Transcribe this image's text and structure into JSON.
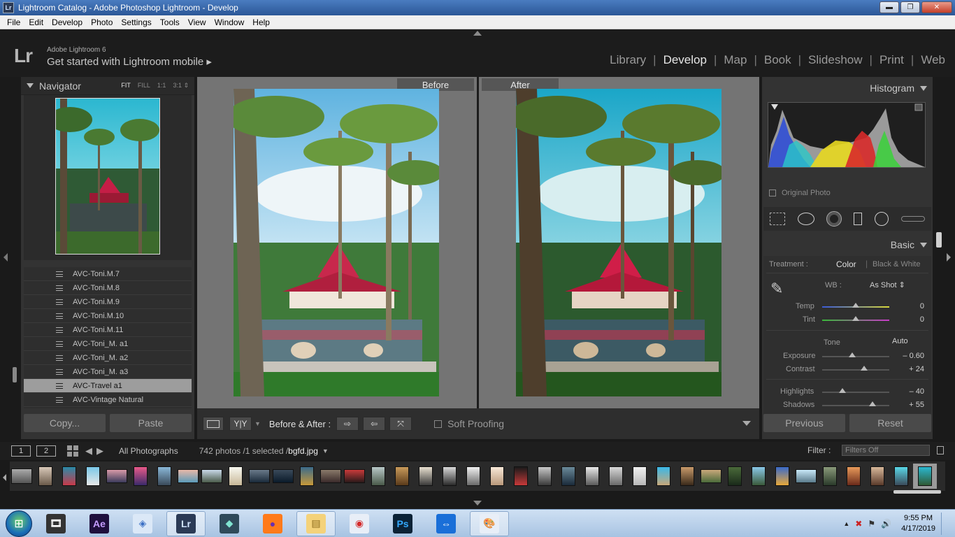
{
  "window": {
    "title": "Lightroom Catalog - Adobe Photoshop Lightroom - Develop",
    "app_icon_label": "Lr",
    "buttons": {
      "minimize": "▬",
      "maximize": "❐",
      "close": "✕"
    }
  },
  "menu": [
    "File",
    "Edit",
    "Develop",
    "Photo",
    "Settings",
    "Tools",
    "View",
    "Window",
    "Help"
  ],
  "identity": {
    "logo": "Lr",
    "product": "Adobe Lightroom 6",
    "mobile": "Get started with Lightroom mobile ▸"
  },
  "modules": [
    {
      "label": "Library",
      "active": false
    },
    {
      "label": "Develop",
      "active": true
    },
    {
      "label": "Map",
      "active": false
    },
    {
      "label": "Book",
      "active": false
    },
    {
      "label": "Slideshow",
      "active": false
    },
    {
      "label": "Print",
      "active": false
    },
    {
      "label": "Web",
      "active": false
    }
  ],
  "navigator": {
    "title": "Navigator",
    "zoom": [
      "FIT",
      "FILL",
      "1:1",
      "3:1 ⇕"
    ],
    "selected_zoom": "FIT"
  },
  "presets": [
    {
      "label": "AVC-Toni.M.7",
      "selected": false
    },
    {
      "label": "AVC-Toni.M.8",
      "selected": false
    },
    {
      "label": "AVC-Toni.M.9",
      "selected": false
    },
    {
      "label": "AVC-Toni.M.10",
      "selected": false
    },
    {
      "label": "AVC-Toni.M.11",
      "selected": false
    },
    {
      "label": "AVC-Toni_M. a1",
      "selected": false
    },
    {
      "label": "AVC-Toni_M. a2",
      "selected": false
    },
    {
      "label": "AVC-Toni_M. a3",
      "selected": false
    },
    {
      "label": "AVC-Travel a1",
      "selected": true
    },
    {
      "label": "AVC-Vintage Natural",
      "selected": false
    }
  ],
  "left_buttons": {
    "copy": "Copy...",
    "paste": "Paste"
  },
  "compare": {
    "before_label": "Before",
    "after_label": "After"
  },
  "toolbar": {
    "ba_view": "Y|Y",
    "before_after_label": "Before & After :",
    "soft_proofing": "Soft Proofing"
  },
  "histogram": {
    "title": "Histogram",
    "original_photo": "Original Photo"
  },
  "basic": {
    "title": "Basic",
    "treatment_label": "Treatment :",
    "treatment_color": "Color",
    "treatment_bw": "Black & White",
    "wb_label": "WB :",
    "wb_value": "As Shot ⇕",
    "temp": {
      "label": "Temp",
      "value": "0",
      "pos": 0.5
    },
    "tint": {
      "label": "Tint",
      "value": "0",
      "pos": 0.5
    },
    "tone_label": "Tone",
    "auto_label": "Auto",
    "exposure": {
      "label": "Exposure",
      "value": "– 0.60",
      "pos": 0.45
    },
    "contrast": {
      "label": "Contrast",
      "value": "+ 24",
      "pos": 0.62
    },
    "highlights": {
      "label": "Highlights",
      "value": "– 40",
      "pos": 0.3
    },
    "shadows": {
      "label": "Shadows",
      "value": "+ 55",
      "pos": 0.75
    }
  },
  "right_buttons": {
    "previous": "Previous",
    "reset": "Reset"
  },
  "filmstrip_header": {
    "monitor1": "1",
    "monitor2": "2",
    "source": "All Photographs",
    "count": "742 photos /1 selected /",
    "filename": "bgfd.jpg",
    "filter_label": "Filter :",
    "filter_value": "Filters Off"
  },
  "taskbar": {
    "time": "9:55 PM",
    "date": "4/17/2019",
    "apps": [
      {
        "name": "media-player",
        "label": "🎞",
        "bg": "#333",
        "fg": "#fff"
      },
      {
        "name": "after-effects",
        "label": "Ae",
        "bg": "#1f0f3d",
        "fg": "#c59cff"
      },
      {
        "name": "network-app",
        "label": "◈",
        "bg": "#dbe8f7",
        "fg": "#3a6fc4"
      },
      {
        "name": "lightroom",
        "label": "Lr",
        "bg": "#2b3a55",
        "fg": "#cfe3ff"
      },
      {
        "name": "filmora",
        "label": "◆",
        "bg": "#2f4a5a",
        "fg": "#7fe3d0"
      },
      {
        "name": "firefox",
        "label": "●",
        "bg": "#ff7a1a",
        "fg": "#6a2fb0"
      },
      {
        "name": "file-explorer",
        "label": "▤",
        "bg": "#f4d27a",
        "fg": "#8a6a1a"
      },
      {
        "name": "screen-recorder",
        "label": "◉",
        "bg": "#e8eef7",
        "fg": "#d42a2a"
      },
      {
        "name": "photoshop",
        "label": "Ps",
        "bg": "#0b2236",
        "fg": "#34a9ff"
      },
      {
        "name": "teamviewer",
        "label": "⇔",
        "bg": "#1a6fd8",
        "fg": "#fff"
      },
      {
        "name": "paint",
        "label": "🎨",
        "bg": "#e8eef7",
        "fg": "#333"
      }
    ],
    "active_apps": [
      "lightroom",
      "file-explorer",
      "paint"
    ]
  }
}
